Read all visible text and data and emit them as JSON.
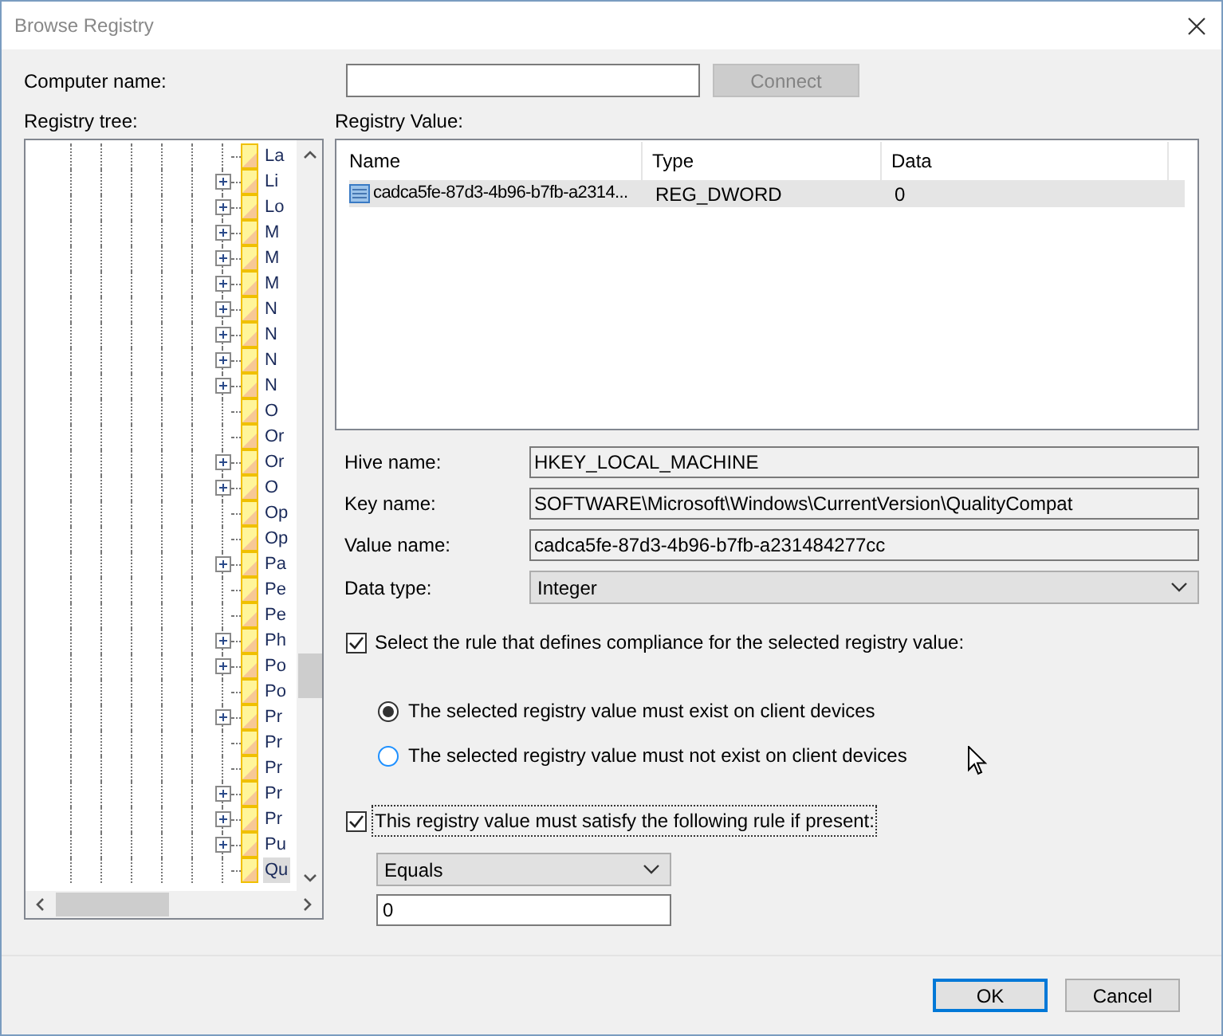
{
  "window": {
    "title": "Browse Registry"
  },
  "computer_name": {
    "label": "Computer name:",
    "connect_button": {
      "label": "Connect",
      "disabled": true
    }
  },
  "registry_tree": {
    "label": "Registry tree:",
    "items": [
      {
        "label": "La",
        "expandable": false,
        "selected": false
      },
      {
        "label": "Li",
        "expandable": true,
        "selected": false
      },
      {
        "label": "Lo",
        "expandable": true,
        "selected": false
      },
      {
        "label": "M",
        "expandable": true,
        "selected": false
      },
      {
        "label": "M",
        "expandable": true,
        "selected": false
      },
      {
        "label": "M",
        "expandable": true,
        "selected": false
      },
      {
        "label": "N",
        "expandable": true,
        "selected": false
      },
      {
        "label": "N",
        "expandable": true,
        "selected": false
      },
      {
        "label": "N",
        "expandable": true,
        "selected": false
      },
      {
        "label": "N",
        "expandable": true,
        "selected": false
      },
      {
        "label": "O",
        "expandable": false,
        "selected": false
      },
      {
        "label": "Or",
        "expandable": false,
        "selected": false
      },
      {
        "label": "Or",
        "expandable": true,
        "selected": false
      },
      {
        "label": "O",
        "expandable": true,
        "selected": false
      },
      {
        "label": "Op",
        "expandable": false,
        "selected": false
      },
      {
        "label": "Op",
        "expandable": false,
        "selected": false
      },
      {
        "label": "Pa",
        "expandable": true,
        "selected": false
      },
      {
        "label": "Pe",
        "expandable": false,
        "selected": false
      },
      {
        "label": "Pe",
        "expandable": false,
        "selected": false
      },
      {
        "label": "Ph",
        "expandable": true,
        "selected": false
      },
      {
        "label": "Po",
        "expandable": true,
        "selected": false
      },
      {
        "label": "Po",
        "expandable": false,
        "selected": false
      },
      {
        "label": "Pr",
        "expandable": true,
        "selected": false
      },
      {
        "label": "Pr",
        "expandable": false,
        "selected": false
      },
      {
        "label": "Pr",
        "expandable": false,
        "selected": false
      },
      {
        "label": "Pr",
        "expandable": true,
        "selected": false
      },
      {
        "label": "Pr",
        "expandable": true,
        "selected": false
      },
      {
        "label": "Pu",
        "expandable": true,
        "selected": false
      },
      {
        "label": "Qu",
        "expandable": false,
        "selected": true
      }
    ]
  },
  "registry_value": {
    "label": "Registry Value:",
    "columns": [
      "Name",
      "Type",
      "Data"
    ],
    "rows": [
      {
        "name": "cadca5fe-87d3-4b96-b7fb-a2314...",
        "type": "REG_DWORD",
        "data": "0",
        "selected": true
      }
    ]
  },
  "fields": [
    {
      "label": "Hive name:",
      "value": "HKEY_LOCAL_MACHINE",
      "kind": "text"
    },
    {
      "label": "Key name:",
      "value": "SOFTWARE\\Microsoft\\Windows\\CurrentVersion\\QualityCompat",
      "kind": "text"
    },
    {
      "label": "Value name:",
      "value": "cadca5fe-87d3-4b96-b7fb-a231484277cc",
      "kind": "text"
    },
    {
      "label": "Data type:",
      "value": "Integer",
      "kind": "dropdown"
    }
  ],
  "compliance_rule": {
    "label": "Select the rule that defines compliance for the selected registry value:",
    "checked": true,
    "options": [
      {
        "label": "The selected registry value must exist on client devices",
        "selected": true
      },
      {
        "label": "The selected registry value must not exist on client devices",
        "selected": false
      }
    ]
  },
  "satisfy_rule": {
    "label": "This registry value must satisfy the following rule if present:",
    "checked": true,
    "operator": "Equals",
    "value": "0"
  },
  "buttons": [
    {
      "label": "OK",
      "default": true
    },
    {
      "label": "Cancel",
      "default": false
    }
  ]
}
